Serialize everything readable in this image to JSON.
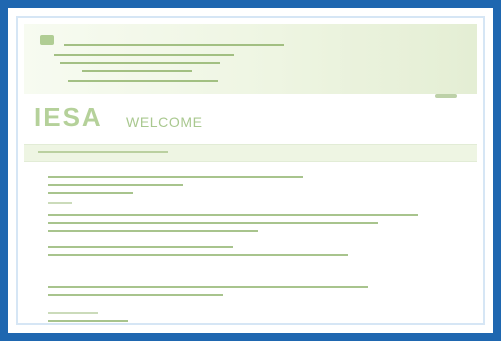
{
  "brand": {
    "logo_text": "IESA",
    "subtitle": "WELCOME"
  },
  "colors": {
    "frame_border": "#1f67b0",
    "header_gradient_start": "#f7fbf1",
    "header_gradient_end": "#e4eed4",
    "nav_bar": "#eef5e3",
    "text_green": "#8bb067"
  }
}
